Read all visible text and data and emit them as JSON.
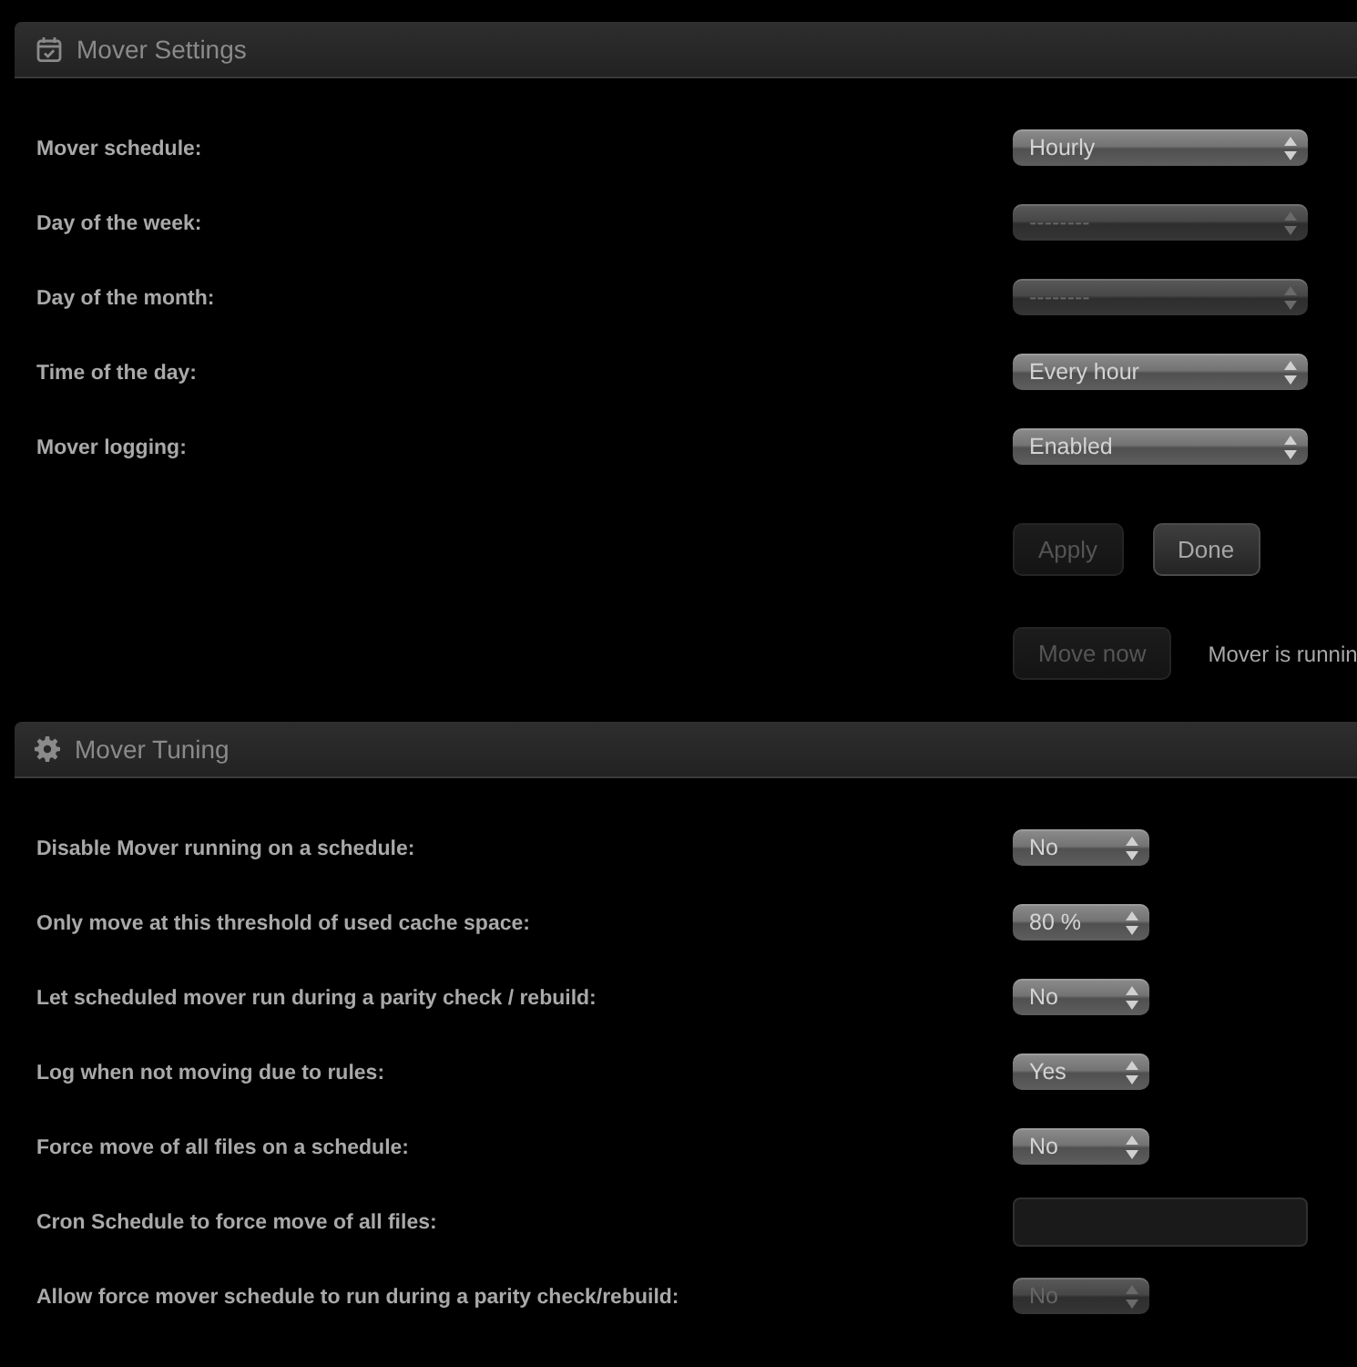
{
  "mover_settings": {
    "title": "Mover Settings",
    "rows": [
      {
        "label": "Mover schedule:",
        "value": "Hourly",
        "disabled": false
      },
      {
        "label": "Day of the week:",
        "value": "--------",
        "disabled": true
      },
      {
        "label": "Day of the month:",
        "value": "--------",
        "disabled": true
      },
      {
        "label": "Time of the day:",
        "value": "Every hour",
        "disabled": false
      },
      {
        "label": "Mover logging:",
        "value": "Enabled",
        "disabled": false
      }
    ],
    "buttons": [
      {
        "label": "Apply",
        "disabled": true
      },
      {
        "label": "Done",
        "disabled": false
      }
    ],
    "move_now": {
      "label": "Move now",
      "disabled": true
    },
    "status": "Mover is runnin"
  },
  "mover_tuning": {
    "title": "Mover Tuning",
    "rows": [
      {
        "kind": "select",
        "label": "Disable Mover running on a schedule:",
        "value": "No",
        "disabled": false
      },
      {
        "kind": "select",
        "label": "Only move at this threshold of used cache space:",
        "value": "80 %",
        "disabled": false
      },
      {
        "kind": "select",
        "label": "Let scheduled mover run during a parity check / rebuild:",
        "value": "No",
        "disabled": false
      },
      {
        "kind": "select",
        "label": "Log when not moving due to rules:",
        "value": "Yes",
        "disabled": false
      },
      {
        "kind": "select",
        "label": "Force move of all files on a schedule:",
        "value": "No",
        "disabled": false
      },
      {
        "kind": "text",
        "label": "Cron Schedule to force move of all files:",
        "disabled": true
      },
      {
        "kind": "select",
        "label": "Allow force mover schedule to run during a parity check/rebuild:",
        "value": "No",
        "disabled": true
      }
    ]
  }
}
